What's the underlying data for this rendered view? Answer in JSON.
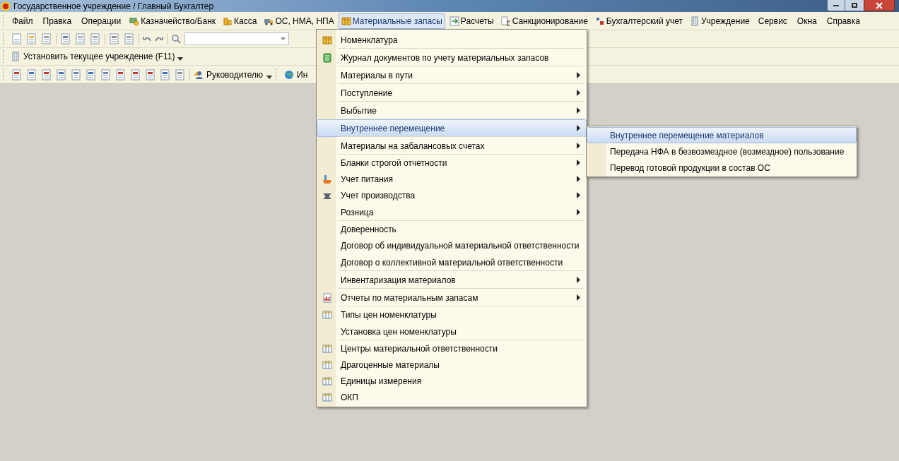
{
  "window": {
    "title": "Государственное учреждение / Главный Бухгалтер"
  },
  "menubar": [
    {
      "label": "Файл",
      "kind": "none",
      "selected": false
    },
    {
      "label": "Правка",
      "kind": "none",
      "selected": false
    },
    {
      "label": "Операции",
      "kind": "none",
      "selected": false
    },
    {
      "label": "Казначейство/Банк",
      "kind": "bank",
      "selected": false
    },
    {
      "label": "Касса",
      "kind": "coins",
      "selected": false
    },
    {
      "label": "ОС, НМА, НПА",
      "kind": "truck",
      "selected": false
    },
    {
      "label": "Материальные запасы",
      "kind": "table",
      "selected": true
    },
    {
      "label": "Расчеты",
      "kind": "arrow",
      "selected": false
    },
    {
      "label": "Санкционирование",
      "kind": "sum",
      "selected": false
    },
    {
      "label": "Бухгалтерский учет",
      "kind": "dtkt",
      "selected": false
    },
    {
      "label": "Учреждение",
      "kind": "building",
      "selected": false
    },
    {
      "label": "Сервис",
      "kind": "none",
      "selected": false
    },
    {
      "label": "Окна",
      "kind": "none",
      "selected": false
    },
    {
      "label": "Справка",
      "kind": "none",
      "selected": false
    }
  ],
  "toolbar_institution": {
    "label": "Установить текущее учреждение (F11)"
  },
  "toolbar_reports": {
    "button": "Руководителю",
    "cut_label": "Ин"
  },
  "menu": [
    {
      "label": "Номенклатура",
      "kind": "table",
      "submenu": false,
      "selected": false,
      "separator_after": true
    },
    {
      "label": "Журнал документов по учету материальных запасов",
      "kind": "journal",
      "submenu": false,
      "selected": false,
      "separator_after": true
    },
    {
      "label": "Материалы в пути",
      "kind": "none",
      "submenu": true,
      "selected": false,
      "separator_after": true
    },
    {
      "label": "Поступление",
      "kind": "none",
      "submenu": true,
      "selected": false,
      "separator_after": true
    },
    {
      "label": "Выбытие",
      "kind": "none",
      "submenu": true,
      "selected": false,
      "separator_after": true
    },
    {
      "label": "Внутреннее перемещение",
      "kind": "none",
      "submenu": true,
      "selected": true,
      "separator_after": true
    },
    {
      "label": "Материалы на забалансовых счетах",
      "kind": "none",
      "submenu": true,
      "selected": false,
      "separator_after": true
    },
    {
      "label": "Бланки строгой отчетности",
      "kind": "none",
      "submenu": true,
      "selected": false,
      "separator_after": false
    },
    {
      "label": "Учет питания",
      "kind": "food",
      "submenu": true,
      "selected": false,
      "separator_after": false
    },
    {
      "label": "Учет производства",
      "kind": "anvil",
      "submenu": true,
      "selected": false,
      "separator_after": false
    },
    {
      "label": "Розница",
      "kind": "none",
      "submenu": true,
      "selected": false,
      "separator_after": true
    },
    {
      "label": "Доверенность",
      "kind": "none",
      "submenu": false,
      "selected": false,
      "separator_after": false
    },
    {
      "label": "Договор об индивидуальной материальной ответственности",
      "kind": "none",
      "submenu": false,
      "selected": false,
      "separator_after": false
    },
    {
      "label": "Договор о коллективной материальной ответственности",
      "kind": "none",
      "submenu": false,
      "selected": false,
      "separator_after": true
    },
    {
      "label": "Инвентаризация материалов",
      "kind": "none",
      "submenu": true,
      "selected": false,
      "separator_after": true
    },
    {
      "label": "Отчеты по материальным запасам",
      "kind": "report",
      "submenu": true,
      "selected": false,
      "separator_after": true
    },
    {
      "label": "Типы цен номенклатуры",
      "kind": "grid",
      "submenu": false,
      "selected": false,
      "separator_after": false
    },
    {
      "label": "Установка цен номенклатуры",
      "kind": "none",
      "submenu": false,
      "selected": false,
      "separator_after": true
    },
    {
      "label": "Центры материальной ответственности",
      "kind": "grid",
      "submenu": false,
      "selected": false,
      "separator_after": false
    },
    {
      "label": "Драгоценные материалы",
      "kind": "grid",
      "submenu": false,
      "selected": false,
      "separator_after": false
    },
    {
      "label": "Единицы измерения",
      "kind": "grid",
      "submenu": false,
      "selected": false,
      "separator_after": false
    },
    {
      "label": "ОКП",
      "kind": "grid",
      "submenu": false,
      "selected": false,
      "separator_after": false
    }
  ],
  "submenu": [
    {
      "label": "Внутреннее перемещение материалов",
      "selected": true
    },
    {
      "label": "Передача НФА в безвозмездное (возмездное) пользование",
      "selected": false
    },
    {
      "label": "Перевод готовой продукции в состав ОС",
      "selected": false
    }
  ]
}
